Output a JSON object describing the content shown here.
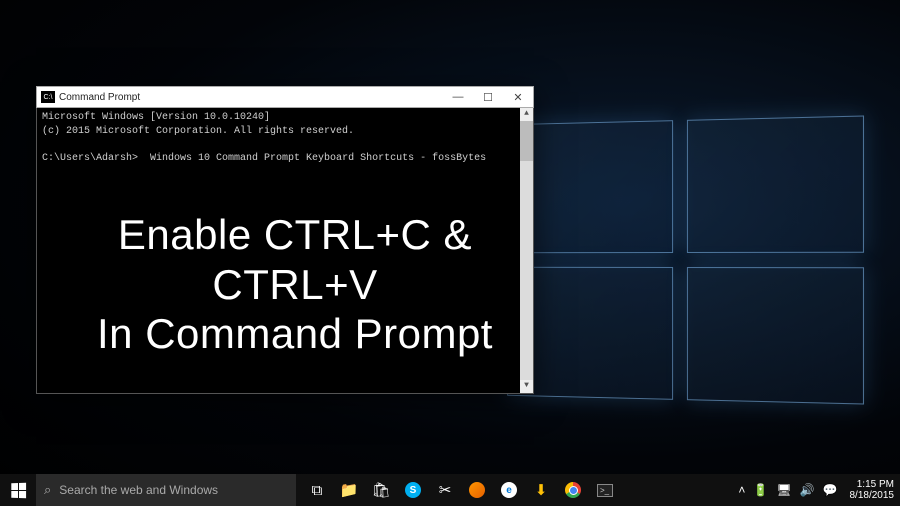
{
  "window": {
    "title": "Command Prompt",
    "icon_label": "C:\\",
    "minimize": "—",
    "maximize": "☐",
    "close": "✕"
  },
  "terminal": {
    "line1": "Microsoft Windows [Version 10.0.10240]",
    "line2": "(c) 2015 Microsoft Corporation. All rights reserved.",
    "prompt": "C:\\Users\\Adarsh>",
    "command": "Windows 10 Command Prompt Keyboard Shortcuts - fossBytes",
    "scroll_up": "▲",
    "scroll_down": "▼"
  },
  "headline": {
    "line1": "Enable CTRL+C & CTRL+V",
    "line2": "In Command Prompt"
  },
  "taskbar": {
    "search_placeholder": "Search the web and Windows",
    "icons": {
      "taskview": "⧉",
      "explorer": "📁",
      "store": "🛍",
      "skype": "S",
      "snip": "✂",
      "firefox": "",
      "edge": "e",
      "download": "⬇",
      "chrome": "",
      "terminal": ">_"
    },
    "tray": {
      "chevron": "˄",
      "battery": "🔋",
      "network": "🖥",
      "volume": "🔊",
      "notifications": "💬"
    },
    "clock": {
      "time": "1:15 PM",
      "date": "8/18/2015"
    }
  }
}
